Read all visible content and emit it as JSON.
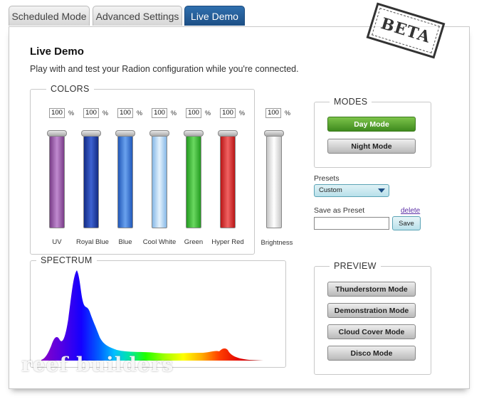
{
  "tabs": [
    {
      "label": "Scheduled Mode",
      "active": false
    },
    {
      "label": "Advanced Settings",
      "active": false
    },
    {
      "label": "Live Demo",
      "active": true
    }
  ],
  "stamp": "BETA",
  "page": {
    "title": "Live Demo",
    "subtitle": "Play with and test your Radion configuration while you're connected."
  },
  "colors": {
    "legend": "COLORS",
    "percent_sign": "%",
    "channels": [
      {
        "name": "UV",
        "value": "100",
        "color": "#9a5aa8"
      },
      {
        "name": "Royal Blue",
        "value": "100",
        "color": "#1f3fa6"
      },
      {
        "name": "Blue",
        "value": "100",
        "color": "#2f72d6"
      },
      {
        "name": "Cool White",
        "value": "100",
        "color": "#a9d1f2"
      },
      {
        "name": "Green",
        "value": "100",
        "color": "#3fb83a"
      },
      {
        "name": "Hyper Red",
        "value": "100",
        "color": "#e02a2a"
      }
    ],
    "brightness": {
      "name": "Brightness",
      "value": "100",
      "color": "#e4e4e4"
    }
  },
  "spectrum": {
    "legend": "SPECTRUM"
  },
  "modes": {
    "legend": "MODES",
    "day": "Day Mode",
    "night": "Night Mode"
  },
  "presets": {
    "label": "Presets",
    "selected": "Custom",
    "save_label": "Save as Preset",
    "delete": "delete",
    "save_button": "Save"
  },
  "preview": {
    "legend": "PREVIEW",
    "buttons": [
      "Thunderstorm Mode",
      "Demonstration Mode",
      "Cloud Cover Mode",
      "Disco Mode"
    ]
  },
  "watermark": "reef builders"
}
